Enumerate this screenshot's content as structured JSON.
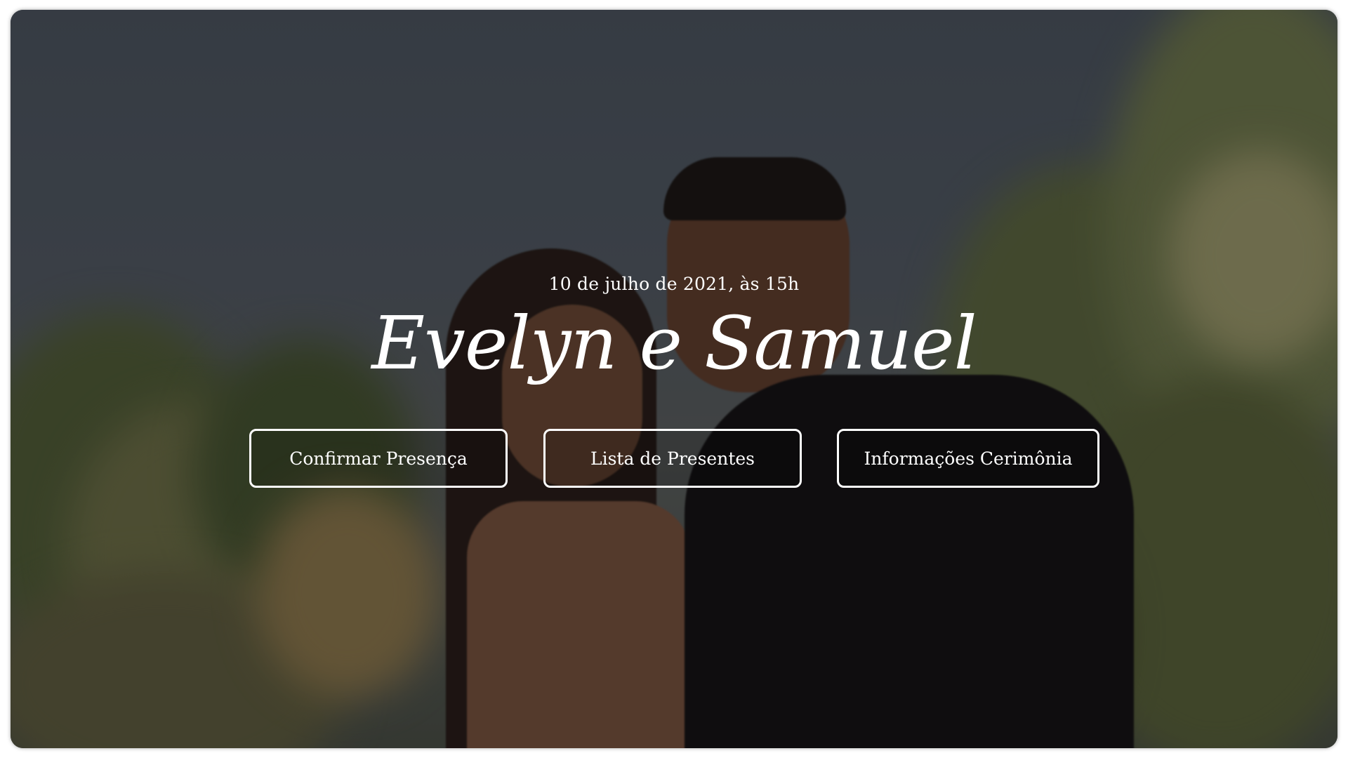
{
  "hero": {
    "date_text": "10 de julho de 2021, às 15h",
    "couple_names": "Evelyn e Samuel"
  },
  "actions": {
    "confirm_label": "Confirmar Presença",
    "gifts_label": "Lista de Presentes",
    "info_label": "Informações Cerimônia"
  },
  "colors": {
    "text": "#ffffff",
    "button_border": "#ffffff",
    "overlay": "rgba(10,10,12,0.42)"
  }
}
